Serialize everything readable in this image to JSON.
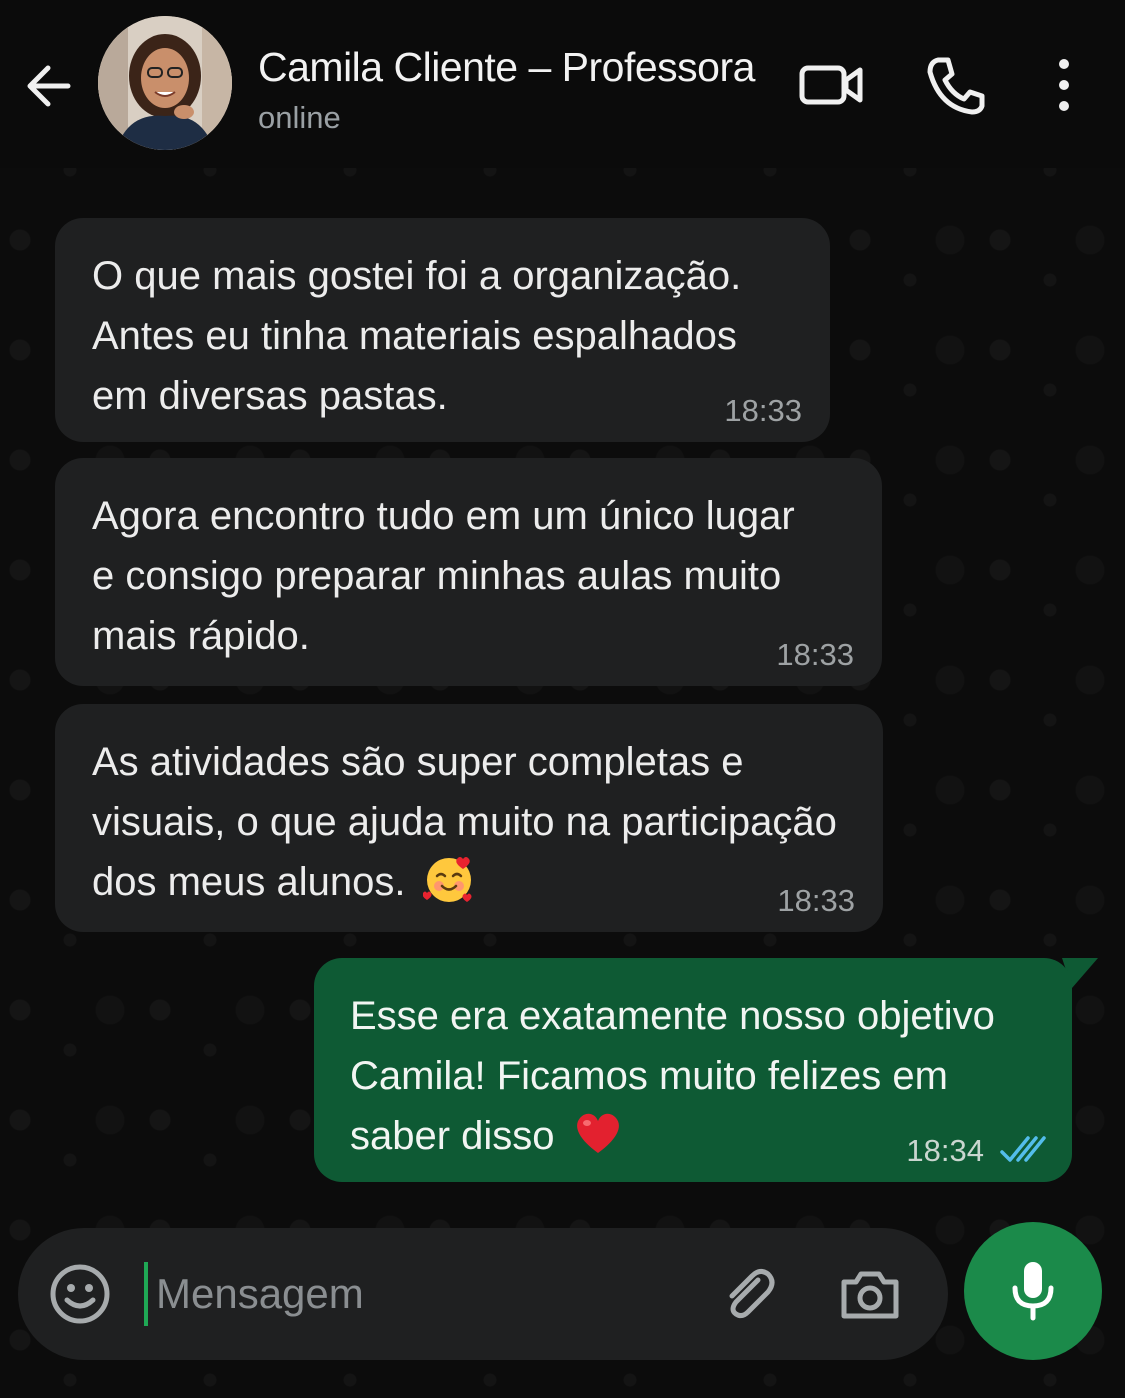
{
  "header": {
    "contact_name": "Camila Cliente – Professora",
    "status": "online"
  },
  "messages": [
    {
      "direction": "incoming",
      "lines": [
        "O que mais gostei foi a organização.",
        "Antes eu tinha materiais espalhados",
        "em diversas pastas."
      ],
      "time": "18:33"
    },
    {
      "direction": "incoming",
      "lines": [
        "Agora encontro tudo em um único lugar",
        "e consigo preparar minhas aulas muito",
        "mais rápido."
      ],
      "time": "18:33"
    },
    {
      "direction": "incoming",
      "lines": [
        "As atividades são super completas e",
        "visuais, o que ajuda muito na participação",
        "dos meus alunos."
      ],
      "emoji": "smiling-face-with-hearts",
      "time": "18:33"
    },
    {
      "direction": "outgoing",
      "lines": [
        "Esse era exatamente nosso objetivo",
        "Camila! Ficamos muito felizes em",
        "saber disso"
      ],
      "emoji": "red-heart",
      "time": "18:34",
      "read_status": "read"
    }
  ],
  "composer": {
    "placeholder": "Mensagem"
  },
  "colors": {
    "background": "#0c0c0c",
    "incoming_bubble": "#1f2021",
    "outgoing_bubble": "#0e5a34",
    "accent": "#1b8a4a",
    "read_ticks": "#53bdeb"
  },
  "icons": [
    "back-arrow-icon",
    "video-call-icon",
    "phone-icon",
    "more-options-icon",
    "emoji-icon",
    "attach-icon",
    "camera-icon",
    "mic-icon"
  ]
}
